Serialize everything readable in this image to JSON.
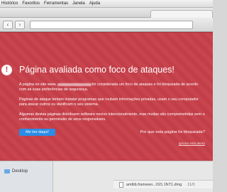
{
  "menubar": {
    "items": [
      "Histórico",
      "Favoritos",
      "Ferramentas",
      "Janela",
      "Ajuda"
    ]
  },
  "warning": {
    "title": "Página avaliada como foco de ataques!",
    "p1_start": "A página no site www.",
    "p1_end": "foi considerada um foco de ataques e foi bloqueada de acordo com as suas preferências de segurança.",
    "p2": "Páginas de ataque tentam instalar programas que roubam informações privadas, usam o seu computador para atacar outros ou danificam o seu sistema.",
    "p3": "Algumas destas páginas distribuem software nocivo intencionalmente, mas muitas são comprometidas sem o conhecimento ou permissão de seus responsáveis.",
    "leave_button": "Me tire daqui!",
    "why_link": "Por que esta página foi bloqueada?",
    "ignore_link": "Ignorar esta alerta"
  },
  "finder": {
    "sidebar_item": "Desktop",
    "download_name": "amtlib.framewo...015.1NT1.dmg",
    "download_date": "11/0"
  },
  "colors": {
    "warning_bg": "#c8414b",
    "button_blue": "#2a8ce5"
  }
}
